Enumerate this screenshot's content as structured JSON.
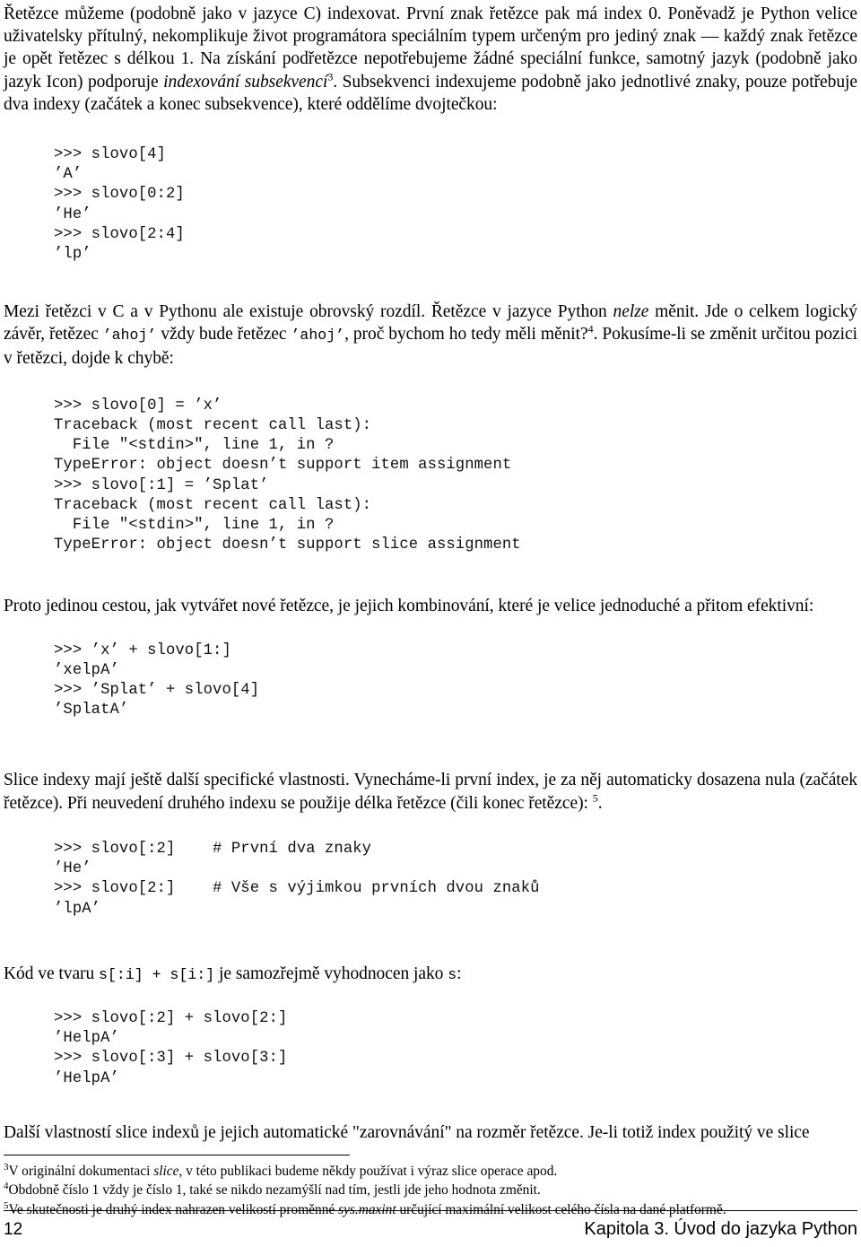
{
  "document": {
    "language": "cs",
    "page_number": "12",
    "chapter_footer": "Kapitola 3.  Úvod do jazyka Python"
  },
  "paragraphs": {
    "p1_a": "Řetězce můžeme (podobně jako v jazyce C) indexovat. První znak řetězce pak má index 0. Poněvadž je Python velice uživatelsky přítulný, nekomplikuje život programátora speciálním typem určeným pro jediný znak — každý znak řetězce je opět řetězec s délkou 1. Na získání podřetězce nepotřebujeme žádné speciální funkce, samotný jazyk (podobně jako jazyk Icon) podporuje ",
    "p1_italic": "indexování subsekvencí",
    "p1_sup": "3",
    "p1_b": ". Subsekvenci indexujeme podobně jako jednotlivé znaky, pouze potřebuje dva indexy (začátek a konec subsekvence), které oddělíme dvojtečkou:",
    "p2_a": "Mezi řetězci v C a v Pythonu ale existuje obrovský rozdíl. Řetězce v jazyce Python ",
    "p2_italic": "nelze",
    "p2_b": " měnit. Jde o celkem logický závěr, řetězec ",
    "p2_code1": "’ahoj’",
    "p2_c": " vždy bude řetězec ",
    "p2_code2": "’ahoj’",
    "p2_d": ", proč bychom ho tedy měli měnit?",
    "p2_sup": "4",
    "p2_e": ". Pokusíme-li se změnit určitou pozici v řetězci, dojde k chybě:",
    "p3": "Proto jedinou cestou, jak vytvářet nové řetězce, je jejich kombinování, které je velice jednoduché a přitom efektivní:",
    "p4_a": "Slice indexy mají ještě další specifické vlastnosti. Vynecháme-li první index, je za něj automaticky dosazena nula (začátek řetězce). Při neuvedení druhého indexu se použije délka řetězce (čili konec řetězce): ",
    "p4_sup": "5",
    "p4_b": ".",
    "p5_a": "Kód ve tvaru ",
    "p5_code1": "s[:i] + s[i:]",
    "p5_b": " je samozřejmě vyhodnocen jako ",
    "p5_code2": "s",
    "p5_c": ":",
    "p6": "Další vlastností slice indexů je jejich automatické \"zarovnávání\" na rozměr řetězce. Je-li totiž index použitý ve slice"
  },
  "code_blocks": {
    "block1": ">>> slovo[4]\n’A’\n>>> slovo[0:2]\n’He’\n>>> slovo[2:4]\n’lp’",
    "block2": ">>> slovo[0] = ’x’\nTraceback (most recent call last):\n  File \"<stdin>\", line 1, in ?\nTypeError: object doesn’t support item assignment\n>>> slovo[:1] = ’Splat’\nTraceback (most recent call last):\n  File \"<stdin>\", line 1, in ?\nTypeError: object doesn’t support slice assignment",
    "block3": ">>> ’x’ + slovo[1:]\n’xelpA’\n>>> ’Splat’ + slovo[4]\n’SplatA’",
    "block4": ">>> slovo[:2]    # První dva znaky\n’He’\n>>> slovo[2:]    # Vše s výjimkou prvních dvou znaků\n’lpA’",
    "block5": ">>> slovo[:2] + slovo[2:]\n’HelpA’\n>>> slovo[:3] + slovo[3:]\n’HelpA’"
  },
  "footnotes": {
    "f3_num": "3",
    "f3_a": "V originální dokumentaci ",
    "f3_italic": "slice",
    "f3_b": ", v této publikaci budeme někdy používat i výraz slice operace apod.",
    "f4_num": "4",
    "f4_text": "Obdobně číslo 1 vždy je číslo 1, také se nikdo nezamýšlí nad tím, jestli jde jeho hodnota změnit.",
    "f5_num": "5",
    "f5_a": "Ve skutečnosti je druhý index nahrazen velikostí proměnné ",
    "f5_italic": "sys.maxint",
    "f5_b": " určující maximální velikost celého čísla na dané platformě."
  }
}
